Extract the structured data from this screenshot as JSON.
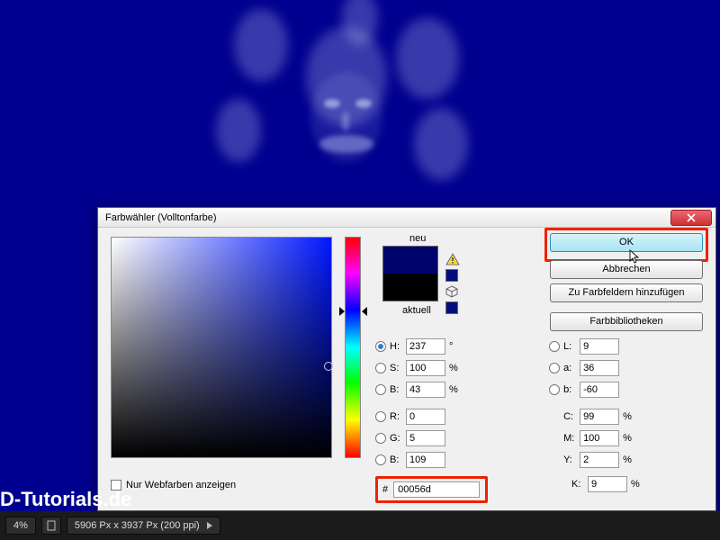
{
  "dialog": {
    "title": "Farbwähler (Volltonfarbe)",
    "buttons": {
      "ok": "OK",
      "cancel": "Abbrechen",
      "add_swatch": "Zu Farbfeldern hinzufügen",
      "libraries": "Farbbibliotheken"
    },
    "swatch": {
      "new_label": "neu",
      "current_label": "aktuell",
      "new_color": "#00056d",
      "current_color": "#000000"
    },
    "hsb": {
      "h": "237",
      "h_unit": "°",
      "s": "100",
      "s_unit": "%",
      "b": "43",
      "b_unit": "%"
    },
    "rgb": {
      "r": "0",
      "g": "5",
      "b": "109"
    },
    "lab": {
      "l": "9",
      "a": "36",
      "b": "-60"
    },
    "cmyk": {
      "c": "99",
      "m": "100",
      "y": "2",
      "k": "9",
      "unit": "%"
    },
    "labels": {
      "h": "H:",
      "s": "S:",
      "b": "B:",
      "r": "R:",
      "g": "G:",
      "bl": "B:",
      "l": "L:",
      "a": "a:",
      "lb": "b:",
      "c": "C:",
      "m": "M:",
      "y": "Y:",
      "k": "K:",
      "hash": "#"
    },
    "hex": "00056d",
    "web_only": "Nur Webfarben anzeigen",
    "selected_radio": "H"
  },
  "status": {
    "zoom": "4%",
    "dims": "5906 Px x 3937 Px (200 ppi)"
  },
  "brand": "D-Tutorials.de"
}
